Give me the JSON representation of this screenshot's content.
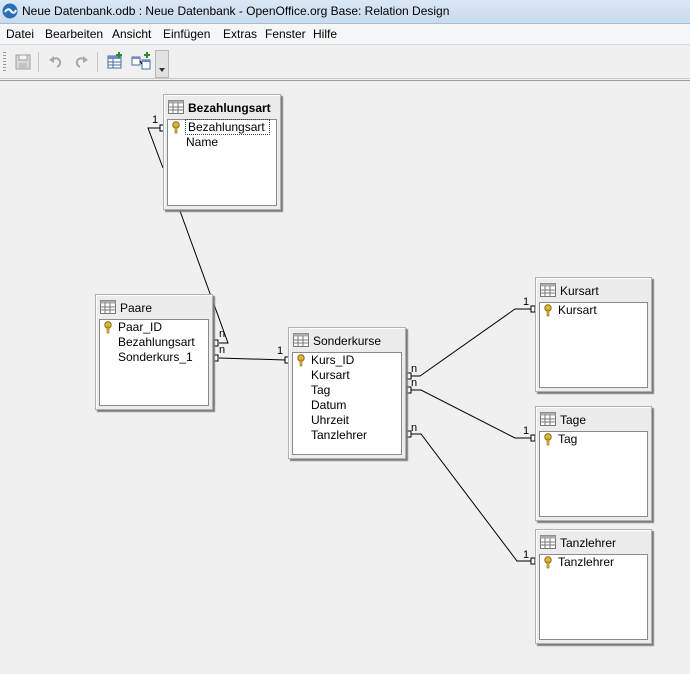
{
  "window": {
    "title": "Neue Datenbank.odb : Neue Datenbank - OpenOffice.org Base: Relation Design"
  },
  "menu": [
    {
      "key": "D",
      "rest": "atei"
    },
    {
      "key": "B",
      "rest": "earbeiten"
    },
    {
      "key": "A",
      "rest": "nsicht"
    },
    {
      "key": "E",
      "rest": "infügen"
    },
    {
      "key": "E",
      "rest": "xtras",
      "split": 1
    },
    {
      "key": "s",
      "rest": "ter",
      "pre": "Fen"
    },
    {
      "key": "H",
      "rest": "ilfe"
    }
  ],
  "menu_labels": [
    "Datei",
    "Bearbeiten",
    "Ansicht",
    "Einfügen",
    "Extras",
    "Fenster",
    "Hilfe"
  ],
  "toolbar": {
    "buttons": [
      {
        "name": "save-icon",
        "enabled": false
      },
      {
        "name": "undo-icon",
        "enabled": false
      },
      {
        "name": "redo-icon",
        "enabled": false
      },
      {
        "name": "add-tables-icon",
        "enabled": true
      },
      {
        "name": "new-relation-icon",
        "enabled": true
      }
    ]
  },
  "tables": {
    "bezahlungsart": {
      "name": "Bezahlungsart",
      "fields": [
        "Bezahlungsart",
        "Name"
      ],
      "key": [
        0
      ],
      "selected": 0
    },
    "paare": {
      "name": "Paare",
      "fields": [
        "Paar_ID",
        "Bezahlungsart",
        "Sonderkurs_1"
      ],
      "key": [
        0
      ]
    },
    "sonderkurse": {
      "name": "Sonderkurse",
      "fields": [
        "Kurs_ID",
        "Kursart",
        "Tag",
        "Datum",
        "Uhrzeit",
        "Tanzlehrer"
      ],
      "key": [
        0
      ]
    },
    "kursart": {
      "name": "Kursart",
      "fields": [
        "Kursart"
      ],
      "key": [
        0
      ]
    },
    "tage": {
      "name": "Tage",
      "fields": [
        "Tag"
      ],
      "key": [
        0
      ]
    },
    "tanzlehrer": {
      "name": "Tanzlehrer",
      "fields": [
        "Tanzlehrer"
      ],
      "key": [
        0
      ]
    }
  },
  "cardinality": {
    "one": "1",
    "many": "n"
  },
  "colors": {
    "canvas": "#f0f0f0",
    "line": "#000000",
    "titlebar": "#c9dbef"
  }
}
